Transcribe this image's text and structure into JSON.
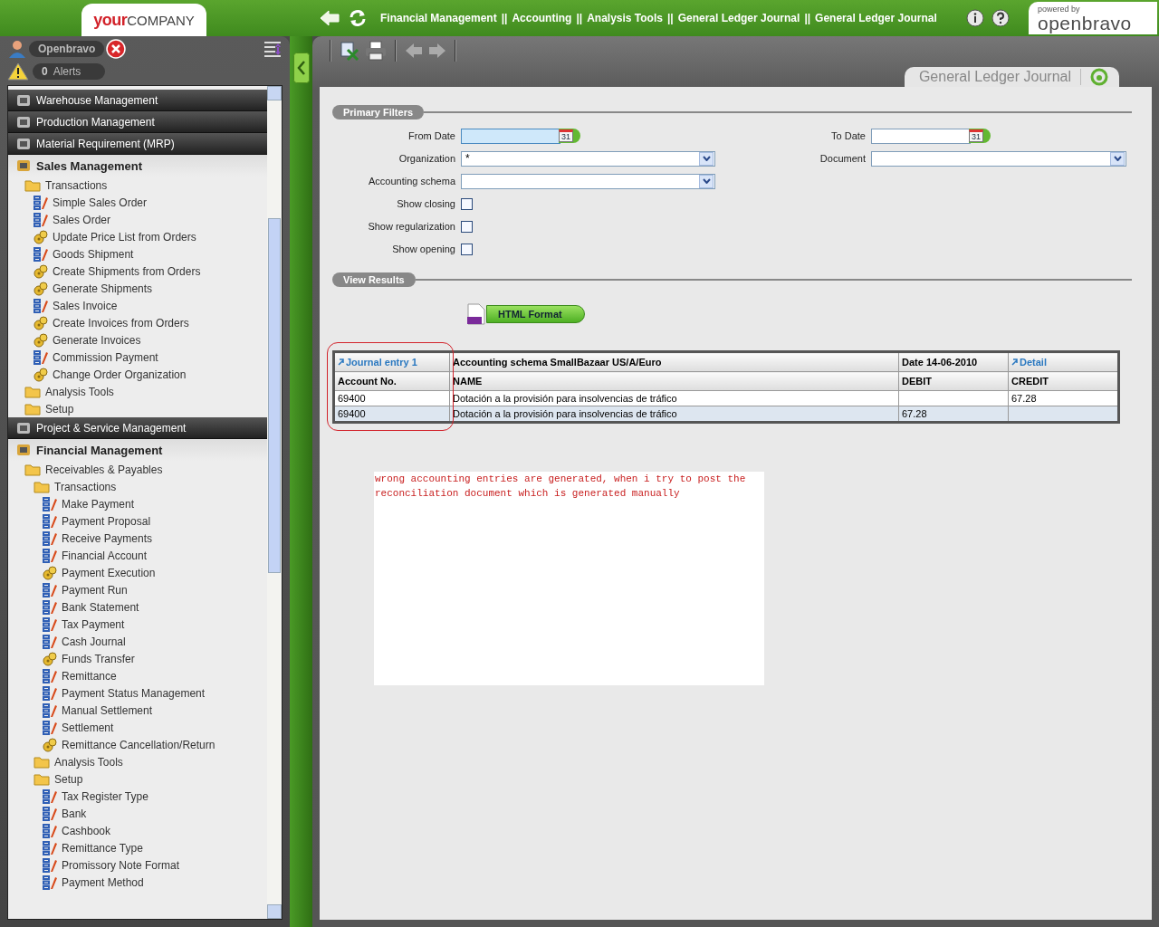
{
  "header": {
    "logo": {
      "brand_a": "your",
      "brand_b": "COMPANY"
    },
    "breadcrumb": {
      "separator": "||",
      "items": [
        "Financial Management",
        "Accounting",
        "Analysis Tools",
        "General Ledger Journal",
        "General Ledger Journal"
      ]
    },
    "powered_by": {
      "caption": "powered by",
      "brand": "openbravo"
    }
  },
  "user": {
    "name": "Openbravo",
    "alerts_count": "0",
    "alerts_label": "Alerts"
  },
  "menu": [
    {
      "label": "Warehouse Management",
      "kind": "module",
      "expanded": false
    },
    {
      "label": "Production Management",
      "kind": "module",
      "expanded": false
    },
    {
      "label": "Material Requirement (MRP)",
      "kind": "module",
      "expanded": false
    },
    {
      "label": "Sales Management",
      "kind": "module",
      "expanded": true,
      "children": [
        {
          "label": "Transactions",
          "kind": "folder",
          "children": [
            {
              "label": "Simple Sales Order",
              "kind": "window"
            },
            {
              "label": "Sales Order",
              "kind": "window"
            },
            {
              "label": "Update Price List from Orders",
              "kind": "process"
            },
            {
              "label": "Goods Shipment",
              "kind": "window"
            },
            {
              "label": "Create Shipments from Orders",
              "kind": "process"
            },
            {
              "label": "Generate Shipments",
              "kind": "process"
            },
            {
              "label": "Sales Invoice",
              "kind": "window"
            },
            {
              "label": "Create Invoices from Orders",
              "kind": "process"
            },
            {
              "label": "Generate Invoices",
              "kind": "process"
            },
            {
              "label": "Commission Payment",
              "kind": "window"
            },
            {
              "label": "Change Order Organization",
              "kind": "process"
            }
          ]
        },
        {
          "label": "Analysis Tools",
          "kind": "folder"
        },
        {
          "label": "Setup",
          "kind": "folder"
        }
      ]
    },
    {
      "label": "Project & Service Management",
      "kind": "module",
      "expanded": false
    },
    {
      "label": "Financial Management",
      "kind": "module",
      "expanded": true,
      "children": [
        {
          "label": "Receivables & Payables",
          "kind": "folder",
          "children": [
            {
              "label": "Transactions",
              "kind": "folder",
              "children": [
                {
                  "label": "Make Payment",
                  "kind": "window"
                },
                {
                  "label": "Payment Proposal",
                  "kind": "window"
                },
                {
                  "label": "Receive Payments",
                  "kind": "window"
                },
                {
                  "label": "Financial Account",
                  "kind": "window"
                },
                {
                  "label": "Payment Execution",
                  "kind": "process"
                },
                {
                  "label": "Payment Run",
                  "kind": "window"
                },
                {
                  "label": "Bank Statement",
                  "kind": "window"
                },
                {
                  "label": "Tax Payment",
                  "kind": "window"
                },
                {
                  "label": "Cash Journal",
                  "kind": "window"
                },
                {
                  "label": "Funds Transfer",
                  "kind": "process"
                },
                {
                  "label": "Remittance",
                  "kind": "window"
                },
                {
                  "label": "Payment Status Management",
                  "kind": "window"
                },
                {
                  "label": "Manual Settlement",
                  "kind": "window"
                },
                {
                  "label": "Settlement",
                  "kind": "window"
                },
                {
                  "label": "Remittance Cancellation/Return",
                  "kind": "process"
                }
              ]
            },
            {
              "label": "Analysis Tools",
              "kind": "folder"
            },
            {
              "label": "Setup",
              "kind": "folder",
              "children": [
                {
                  "label": "Tax Register Type",
                  "kind": "window"
                },
                {
                  "label": "Bank",
                  "kind": "window"
                },
                {
                  "label": "Cashbook",
                  "kind": "window"
                },
                {
                  "label": "Remittance Type",
                  "kind": "window"
                },
                {
                  "label": "Promissory Note Format",
                  "kind": "window"
                },
                {
                  "label": "Payment Method",
                  "kind": "window"
                }
              ]
            }
          ]
        }
      ]
    }
  ],
  "window_tab": "General Ledger Journal",
  "primary_filters": {
    "title": "Primary Filters",
    "left": [
      {
        "label": "From Date",
        "kind": "date",
        "calendar_label": "31",
        "focused": true
      },
      {
        "label": "Organization",
        "kind": "select",
        "value": "*"
      },
      {
        "label": "Accounting schema",
        "kind": "select"
      },
      {
        "label": "Show closing",
        "kind": "checkbox",
        "checked": false
      },
      {
        "label": "Show regularization",
        "kind": "checkbox",
        "checked": false
      },
      {
        "label": "Show opening",
        "kind": "checkbox",
        "checked": false
      }
    ],
    "right": [
      {
        "label": "To Date",
        "kind": "date",
        "calendar_label": "31",
        "focused": false
      },
      {
        "label": "Document",
        "kind": "select"
      }
    ]
  },
  "view_results": {
    "title": "View Results",
    "button": "HTML Format"
  },
  "table": {
    "group_header": [
      {
        "text": "Journal entry 1",
        "kind": "link"
      },
      {
        "text": "Accounting schema SmallBazaar US/A/Euro",
        "kind": "text"
      },
      {
        "text": "Date 14-06-2010",
        "kind": "text"
      },
      {
        "text": "Detail",
        "kind": "link"
      }
    ],
    "columns": [
      "Account No.",
      "NAME",
      "DEBIT",
      "CREDIT"
    ],
    "rows": [
      {
        "selected": false,
        "cells": [
          "69400",
          "Dotación a la provisión para insolvencias de tráfico",
          "",
          "67.28"
        ]
      },
      {
        "selected": true,
        "cells": [
          "69400",
          "Dotación a la provisión para insolvencias de tráfico",
          "67.28",
          ""
        ]
      }
    ]
  },
  "note": {
    "lines": [
      "wrong accounting entries are generated, when i try to post the",
      "reconciliation document which is generated manually"
    ]
  }
}
